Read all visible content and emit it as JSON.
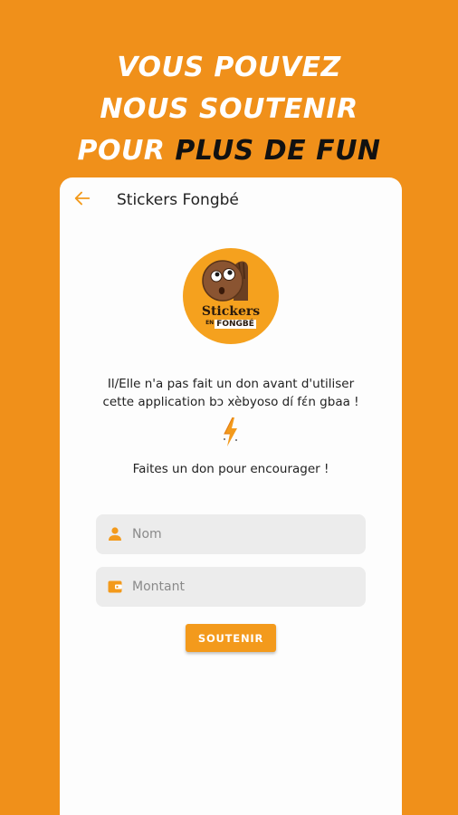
{
  "headline": {
    "line1": "VOUS POUVEZ",
    "line2": "NOUS SOUTENIR",
    "line3_prefix": "POUR ",
    "line3_highlight": "PLUS DE FUN"
  },
  "appbar": {
    "back_icon": "arrow-left-icon",
    "title": "Stickers Fongbé"
  },
  "logo": {
    "line1": "Stickers",
    "line2_small": "EN",
    "line2_brand": "FONGBÉ"
  },
  "message": {
    "line1": "Il/Elle n'a pas fait un don avant d'utiliser",
    "line2": "cette application bɔ xèbyoso dí fɛ́n gbaa !"
  },
  "bolt_icon": "lightning-bolt-icon",
  "encourage": "Faites un don pour encourager !",
  "form": {
    "name_placeholder": "Nom",
    "name_icon": "person-icon",
    "amount_placeholder": "Montant",
    "amount_icon": "wallet-icon",
    "submit_label": "SOUTENIR"
  },
  "colors": {
    "background": "#F0901A",
    "accent": "#F39A1C",
    "field": "#ECECEC"
  }
}
